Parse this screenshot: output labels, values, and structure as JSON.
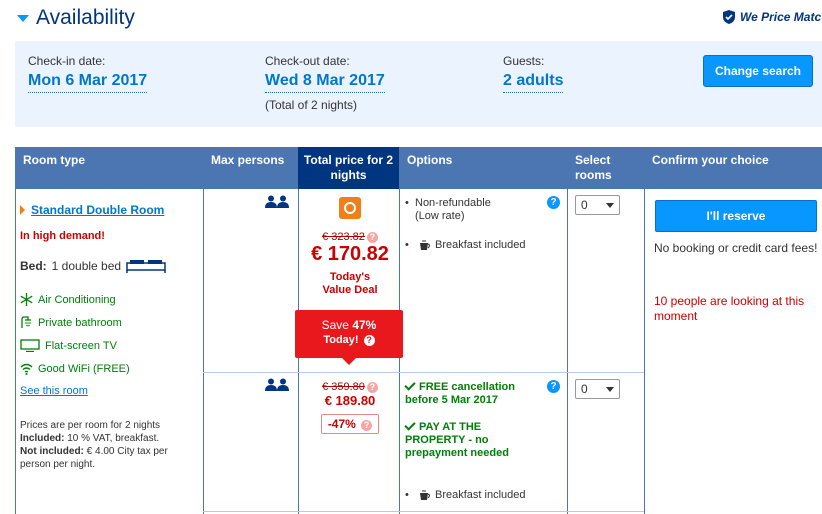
{
  "header": {
    "title": "Availability",
    "price_match": "We Price Matc"
  },
  "search": {
    "checkin_label": "Check-in date:",
    "checkin_value": "Mon 6 Mar 2017",
    "checkout_label": "Check-out date:",
    "checkout_value": "Wed 8 Mar 2017",
    "total_nights": "(Total of 2 nights)",
    "guests_label": "Guests:",
    "guests_value": "2 adults",
    "change_button": "Change search"
  },
  "table": {
    "headers": {
      "room_type": "Room type",
      "max_persons": "Max persons",
      "total_price": "Total price for 2 nights",
      "options": "Options",
      "select_rooms": "Select rooms",
      "confirm": "Confirm your choice"
    },
    "room": {
      "name": "Standard Double Room",
      "demand": "In high demand!",
      "bed_label": "Bed:",
      "bed_value": "1 double bed",
      "facilities": [
        {
          "label": "Air Conditioning",
          "icon": "snowflake-icon"
        },
        {
          "label": "Private bathroom",
          "icon": "shower-icon"
        },
        {
          "label": "Flat-screen TV",
          "icon": "tv-icon"
        },
        {
          "label": "Good WiFi (FREE)",
          "icon": "wifi-icon"
        }
      ],
      "see_room": "See this room",
      "prices_note_1": "Prices are per room for 2 nights",
      "included_label": "Included:",
      "included_value": "10 % VAT, breakfast.",
      "not_included_label": "Not included:",
      "not_included_value": "€ 4.00 City tax per person per night."
    },
    "offers": [
      {
        "original_price": "€ 323.82",
        "price": "€ 170.82",
        "deal_label": "Today's Value Deal",
        "save_prefix": "Save",
        "save_percent": "47%",
        "save_today": "Today!",
        "options": [
          "Non-refundable",
          "(Low rate)",
          "Breakfast included"
        ],
        "select_value": "0"
      },
      {
        "original_price": "€ 359.80",
        "price": "€ 189.80",
        "discount": "-47%",
        "free_cancel": "FREE cancellation before 5 Mar 2017",
        "pay_at_property": "PAY AT THE PROPERTY - no prepayment needed",
        "breakfast": "Breakfast included",
        "select_value": "0"
      }
    ],
    "confirm": {
      "reserve_button": "I'll reserve",
      "no_fees": "No booking or credit card fees!",
      "looking": "10 people are looking at this moment"
    }
  },
  "colors": {
    "brand_blue": "#003580",
    "header_blue": "#4c76b2",
    "button_blue": "#0896ff",
    "deal_red": "#e8181c",
    "green": "#008009"
  }
}
